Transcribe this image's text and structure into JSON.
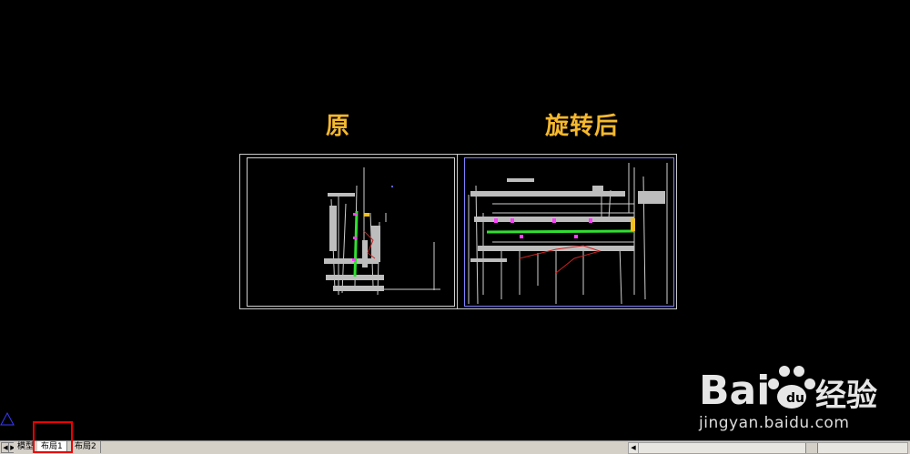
{
  "drawing": {
    "title_left": "原",
    "title_right": "旋转后"
  },
  "tabs": [
    {
      "label": "模型",
      "active": false
    },
    {
      "label": "布局1",
      "active": true
    },
    {
      "label": "布局2",
      "active": false
    }
  ],
  "watermark": {
    "brand": "Baidu经验",
    "url": "jingyan.baidu.com"
  },
  "colors": {
    "title": "#f5b82e",
    "highlight": "#ee0000",
    "background": "#000000"
  }
}
